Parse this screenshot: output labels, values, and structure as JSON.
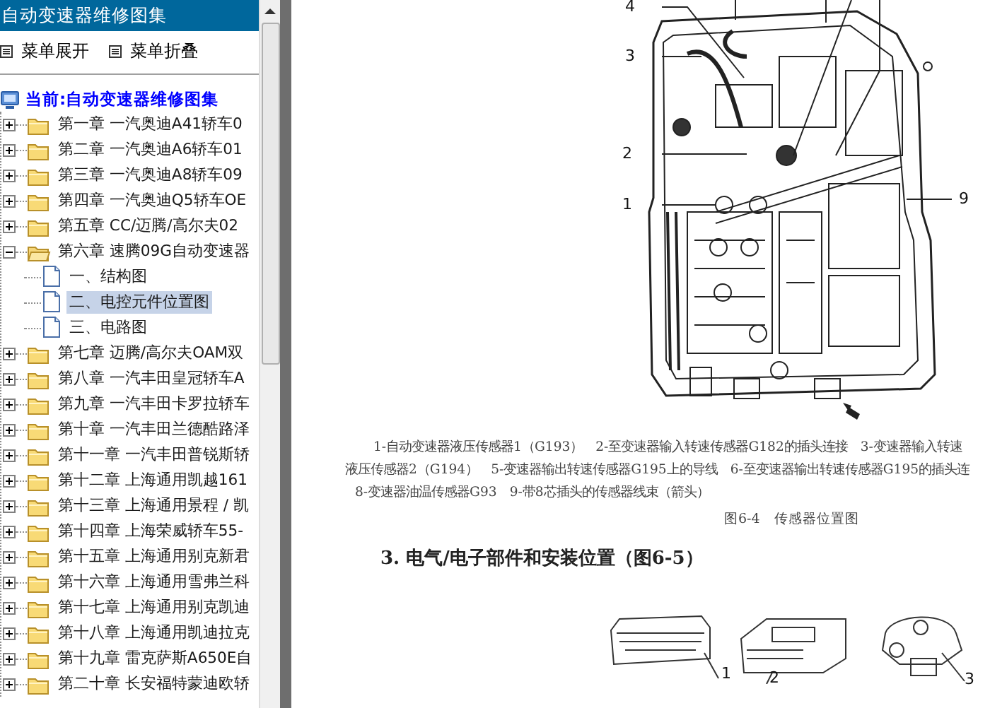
{
  "panel": {
    "title": "自动变速器维修图集",
    "toolbar": [
      {
        "label": "菜单展开"
      },
      {
        "label": "菜单折叠"
      }
    ]
  },
  "tree": {
    "root": "当前:自动变速器维修图集",
    "items": [
      {
        "label": "第一章 一汽奥迪A41轿车0",
        "expanded": false,
        "selected": false
      },
      {
        "label": "第二章 一汽奥迪A6轿车01",
        "expanded": false,
        "selected": false
      },
      {
        "label": "第三章 一汽奥迪A8轿车09",
        "expanded": false,
        "selected": false
      },
      {
        "label": "第四章 一汽奥迪Q5轿车OE",
        "expanded": false,
        "selected": false
      },
      {
        "label": "第五章 CC/迈腾/高尔夫02",
        "expanded": false,
        "selected": false
      },
      {
        "label": "第六章 速腾09G自动变速器",
        "expanded": true,
        "selected": false,
        "children": [
          {
            "label": "一、结构图",
            "selected": false
          },
          {
            "label": "二、电控元件位置图",
            "selected": true
          },
          {
            "label": "三、电路图",
            "selected": false
          }
        ]
      },
      {
        "label": "第七章 迈腾/高尔夫OAM双",
        "expanded": false,
        "selected": false
      },
      {
        "label": "第八章 一汽丰田皇冠轿车A",
        "expanded": false,
        "selected": false
      },
      {
        "label": "第九章 一汽丰田卡罗拉轿车",
        "expanded": false,
        "selected": false
      },
      {
        "label": "第十章 一汽丰田兰德酷路泽",
        "expanded": false,
        "selected": false
      },
      {
        "label": "第十一章 一汽丰田普锐斯轿",
        "expanded": false,
        "selected": false
      },
      {
        "label": "第十二章 上海通用凯越161",
        "expanded": false,
        "selected": false
      },
      {
        "label": "第十三章 上海通用景程 / 凯",
        "expanded": false,
        "selected": false
      },
      {
        "label": "第十四章 上海荣威轿车55-",
        "expanded": false,
        "selected": false
      },
      {
        "label": "第十五章 上海通用别克新君",
        "expanded": false,
        "selected": false
      },
      {
        "label": "第十六章 上海通用雪弗兰科",
        "expanded": false,
        "selected": false
      },
      {
        "label": "第十七章 上海通用别克凯迪",
        "expanded": false,
        "selected": false
      },
      {
        "label": "第十八章 上海通用凯迪拉克",
        "expanded": false,
        "selected": false
      },
      {
        "label": "第十九章 雷克萨斯A650E自",
        "expanded": false,
        "selected": false
      },
      {
        "label": "第二十章 长安福特蒙迪欧轿",
        "expanded": false,
        "selected": false
      }
    ]
  },
  "document": {
    "callouts": [
      {
        "text": "4"
      },
      {
        "text": "3"
      },
      {
        "text": "2"
      },
      {
        "text": "1"
      },
      {
        "text": "9"
      }
    ],
    "legend": [
      "1-自动变速器液压传感器1（G193）　2-至变速器输入转速传感器G182的插头连接　3-变速器输入转速",
      "液压传感器2（G194）　5-变速器输出转速传感器G195上的导线　6-至变速器输出转速传感器G195的插头连",
      "8-变速器油温传感器G93　9-带8芯插头的传感器线束（箭头）"
    ],
    "figure_caption": "图6-4　传感器位置图",
    "heading": "3. 电气/电子部件和安装位置（图6-5）",
    "part_labels": [
      {
        "text": "1"
      },
      {
        "text": "2"
      },
      {
        "text": "3"
      }
    ]
  }
}
